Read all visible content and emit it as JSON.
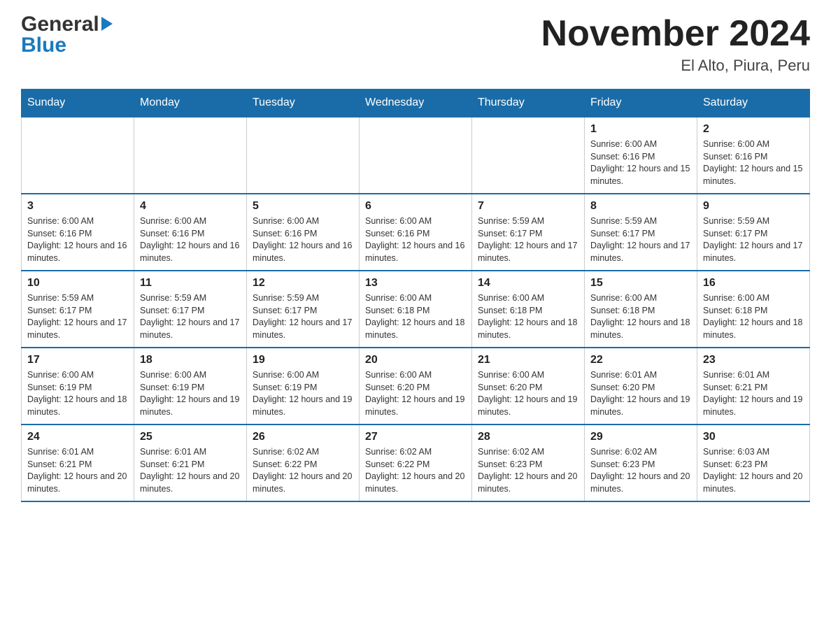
{
  "header": {
    "title": "November 2024",
    "subtitle": "El Alto, Piura, Peru",
    "logo_general": "General",
    "logo_blue": "Blue"
  },
  "weekdays": [
    "Sunday",
    "Monday",
    "Tuesday",
    "Wednesday",
    "Thursday",
    "Friday",
    "Saturday"
  ],
  "weeks": [
    [
      {
        "day": "",
        "sunrise": "",
        "sunset": "",
        "daylight": ""
      },
      {
        "day": "",
        "sunrise": "",
        "sunset": "",
        "daylight": ""
      },
      {
        "day": "",
        "sunrise": "",
        "sunset": "",
        "daylight": ""
      },
      {
        "day": "",
        "sunrise": "",
        "sunset": "",
        "daylight": ""
      },
      {
        "day": "",
        "sunrise": "",
        "sunset": "",
        "daylight": ""
      },
      {
        "day": "1",
        "sunrise": "Sunrise: 6:00 AM",
        "sunset": "Sunset: 6:16 PM",
        "daylight": "Daylight: 12 hours and 15 minutes."
      },
      {
        "day": "2",
        "sunrise": "Sunrise: 6:00 AM",
        "sunset": "Sunset: 6:16 PM",
        "daylight": "Daylight: 12 hours and 15 minutes."
      }
    ],
    [
      {
        "day": "3",
        "sunrise": "Sunrise: 6:00 AM",
        "sunset": "Sunset: 6:16 PM",
        "daylight": "Daylight: 12 hours and 16 minutes."
      },
      {
        "day": "4",
        "sunrise": "Sunrise: 6:00 AM",
        "sunset": "Sunset: 6:16 PM",
        "daylight": "Daylight: 12 hours and 16 minutes."
      },
      {
        "day": "5",
        "sunrise": "Sunrise: 6:00 AM",
        "sunset": "Sunset: 6:16 PM",
        "daylight": "Daylight: 12 hours and 16 minutes."
      },
      {
        "day": "6",
        "sunrise": "Sunrise: 6:00 AM",
        "sunset": "Sunset: 6:16 PM",
        "daylight": "Daylight: 12 hours and 16 minutes."
      },
      {
        "day": "7",
        "sunrise": "Sunrise: 5:59 AM",
        "sunset": "Sunset: 6:17 PM",
        "daylight": "Daylight: 12 hours and 17 minutes."
      },
      {
        "day": "8",
        "sunrise": "Sunrise: 5:59 AM",
        "sunset": "Sunset: 6:17 PM",
        "daylight": "Daylight: 12 hours and 17 minutes."
      },
      {
        "day": "9",
        "sunrise": "Sunrise: 5:59 AM",
        "sunset": "Sunset: 6:17 PM",
        "daylight": "Daylight: 12 hours and 17 minutes."
      }
    ],
    [
      {
        "day": "10",
        "sunrise": "Sunrise: 5:59 AM",
        "sunset": "Sunset: 6:17 PM",
        "daylight": "Daylight: 12 hours and 17 minutes."
      },
      {
        "day": "11",
        "sunrise": "Sunrise: 5:59 AM",
        "sunset": "Sunset: 6:17 PM",
        "daylight": "Daylight: 12 hours and 17 minutes."
      },
      {
        "day": "12",
        "sunrise": "Sunrise: 5:59 AM",
        "sunset": "Sunset: 6:17 PM",
        "daylight": "Daylight: 12 hours and 17 minutes."
      },
      {
        "day": "13",
        "sunrise": "Sunrise: 6:00 AM",
        "sunset": "Sunset: 6:18 PM",
        "daylight": "Daylight: 12 hours and 18 minutes."
      },
      {
        "day": "14",
        "sunrise": "Sunrise: 6:00 AM",
        "sunset": "Sunset: 6:18 PM",
        "daylight": "Daylight: 12 hours and 18 minutes."
      },
      {
        "day": "15",
        "sunrise": "Sunrise: 6:00 AM",
        "sunset": "Sunset: 6:18 PM",
        "daylight": "Daylight: 12 hours and 18 minutes."
      },
      {
        "day": "16",
        "sunrise": "Sunrise: 6:00 AM",
        "sunset": "Sunset: 6:18 PM",
        "daylight": "Daylight: 12 hours and 18 minutes."
      }
    ],
    [
      {
        "day": "17",
        "sunrise": "Sunrise: 6:00 AM",
        "sunset": "Sunset: 6:19 PM",
        "daylight": "Daylight: 12 hours and 18 minutes."
      },
      {
        "day": "18",
        "sunrise": "Sunrise: 6:00 AM",
        "sunset": "Sunset: 6:19 PM",
        "daylight": "Daylight: 12 hours and 19 minutes."
      },
      {
        "day": "19",
        "sunrise": "Sunrise: 6:00 AM",
        "sunset": "Sunset: 6:19 PM",
        "daylight": "Daylight: 12 hours and 19 minutes."
      },
      {
        "day": "20",
        "sunrise": "Sunrise: 6:00 AM",
        "sunset": "Sunset: 6:20 PM",
        "daylight": "Daylight: 12 hours and 19 minutes."
      },
      {
        "day": "21",
        "sunrise": "Sunrise: 6:00 AM",
        "sunset": "Sunset: 6:20 PM",
        "daylight": "Daylight: 12 hours and 19 minutes."
      },
      {
        "day": "22",
        "sunrise": "Sunrise: 6:01 AM",
        "sunset": "Sunset: 6:20 PM",
        "daylight": "Daylight: 12 hours and 19 minutes."
      },
      {
        "day": "23",
        "sunrise": "Sunrise: 6:01 AM",
        "sunset": "Sunset: 6:21 PM",
        "daylight": "Daylight: 12 hours and 19 minutes."
      }
    ],
    [
      {
        "day": "24",
        "sunrise": "Sunrise: 6:01 AM",
        "sunset": "Sunset: 6:21 PM",
        "daylight": "Daylight: 12 hours and 20 minutes."
      },
      {
        "day": "25",
        "sunrise": "Sunrise: 6:01 AM",
        "sunset": "Sunset: 6:21 PM",
        "daylight": "Daylight: 12 hours and 20 minutes."
      },
      {
        "day": "26",
        "sunrise": "Sunrise: 6:02 AM",
        "sunset": "Sunset: 6:22 PM",
        "daylight": "Daylight: 12 hours and 20 minutes."
      },
      {
        "day": "27",
        "sunrise": "Sunrise: 6:02 AM",
        "sunset": "Sunset: 6:22 PM",
        "daylight": "Daylight: 12 hours and 20 minutes."
      },
      {
        "day": "28",
        "sunrise": "Sunrise: 6:02 AM",
        "sunset": "Sunset: 6:23 PM",
        "daylight": "Daylight: 12 hours and 20 minutes."
      },
      {
        "day": "29",
        "sunrise": "Sunrise: 6:02 AM",
        "sunset": "Sunset: 6:23 PM",
        "daylight": "Daylight: 12 hours and 20 minutes."
      },
      {
        "day": "30",
        "sunrise": "Sunrise: 6:03 AM",
        "sunset": "Sunset: 6:23 PM",
        "daylight": "Daylight: 12 hours and 20 minutes."
      }
    ]
  ]
}
